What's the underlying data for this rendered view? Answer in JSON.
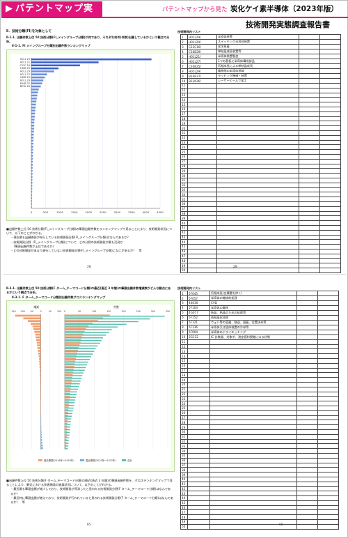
{
  "header": {
    "brand": "パテントマップ実例",
    "subtitle": "パテントマップから見た",
    "title_line1": "炭化ケイ素半導体（2023年版）",
    "title_line2": "技術開発実態調査報告書"
  },
  "page1": {
    "section_heading": "Ⅱ．技術分類(FI)を対象として",
    "subsection": "Ⅱ-1-1. 出願件数上位 50 技術分類(FI_メイングループ分類)が何であり、それぞれ何件(件数)出願しているかという観点で分析。",
    "chart_caption": "Ⅱ-1-1. FI メイングループ分類別出願件数ランキングマップ",
    "bullets": [
      "■出願件数上位 50 技術分類(FI_メイングループ分類)の筆頭出願件数をランキングマップで見ることにより、技術開発状況について、以下のことがわかる。",
      "・現在最も出願開発が先行している技術開発分野(FI_メイングループ分類)はなんであるか？",
      "・技術開発分野（FI_メイングループ分類)について、どの分野の技術開発が最も活発か",
      "（筆頭出願件数が上位であるか）",
      "・どの技術開発があまり進行していない技術開発分野(FI_メイングループ分類)になにがあるか？　等"
    ],
    "page_left": "28",
    "page_right": "29",
    "registry_title": "技術開発内リスト",
    "registry": [
      {
        "no": "1",
        "code": "H01L29/",
        "desc": "半導体装置"
      },
      {
        "no": "2",
        "code": "H01L29/",
        "desc": "スイッチング半導体装置"
      },
      {
        "no": "3",
        "code": "C23C16/",
        "desc": "化学蒸着"
      },
      {
        "no": "4",
        "code": "C30B29/",
        "desc": "単結晶成長装置等"
      },
      {
        "no": "5",
        "code": "H01L21/",
        "desc": "半導体装置製造"
      },
      {
        "no": "6",
        "code": "H01L27/",
        "desc": "1つの基板に半導体構成部品"
      },
      {
        "no": "7",
        "code": "C30B25/",
        "desc": "気相成長による単結晶成長"
      },
      {
        "no": "8",
        "code": "H01L29/",
        "desc": "電極間の半導体領域"
      },
      {
        "no": "9",
        "code": "B24B37/",
        "desc": "ラッピング機械・装置"
      },
      {
        "no": "10",
        "code": "B23K26/",
        "desc": "レーザービームで加工"
      }
    ],
    "x_ticks": [
      "0",
      "500",
      "1000",
      "1500",
      "2000",
      "2500",
      "3000",
      "3500",
      "4000",
      "4500"
    ],
    "bar_labels": [
      "H01L 29",
      "H01L 21",
      "C23C 16",
      "C30B 29",
      "H01L 29",
      "H01L 27",
      "C30B 25",
      "H01L 29",
      "B24B 37",
      "B23K 26"
    ],
    "bar_values": [
      4200,
      2350,
      1700,
      950,
      800,
      550,
      470,
      420,
      380,
      330,
      260,
      230,
      210,
      190,
      175,
      160,
      150,
      140,
      130,
      120,
      110,
      105,
      100,
      95,
      90,
      85,
      80,
      76,
      72,
      68,
      64,
      60,
      57,
      54,
      51,
      48,
      45,
      43,
      41,
      39,
      37,
      35,
      33,
      31,
      29,
      27,
      25,
      23,
      21,
      20
    ]
  },
  "page2": {
    "subsection": "Ⅱ-3-1. 出願件数上位 50 技術分類(F ターム_テーマコード分類)の最近(直近 3 年間)の筆頭出願件数増減数がどんな観点にあるかという観点で分析。",
    "chart_caption": "Ⅱ-3-1. F ターム_テーマコード分類別出願件数グロスランキングマップ",
    "left_header": "増減",
    "right_header": "件数",
    "left_ticks": [
      "-150",
      "-100",
      "-50",
      "0",
      "50",
      "100"
    ],
    "right_ticks": [
      "0",
      "50",
      "100",
      "150",
      "200",
      "250",
      "300",
      "350"
    ],
    "legend": [
      "過去期間(2016年〜2018年)",
      "直近期間(2019年〜2022年)",
      "合計"
    ],
    "legend_colors": [
      "#f0a070",
      "#6fb0e0",
      "#5bc0b0"
    ],
    "bullets": [
      "■出願件数上位 50 技術分類(F ターム_テーマコード分類)の最近(直近 3 年間)の筆頭出願件数を、グロスランキングマップで見ることにより、最近における技術開発の進展状況について、以下のことがわかる。",
      "・最近最も筆頭出願が減少しており、技術開発が停滞したと思われる技術開発分野(F ターム_テーマコード分類)はなんであるか？",
      "・最近特に筆頭出願が増えており、技術開発が行われていると思われる技術開発分野(F ターム_テーマコード分類)はなんであるか？　等"
    ],
    "page_left": "65",
    "page_right": "66",
    "registry_title": "技術開発内リスト",
    "registry": [
      {
        "no": "1",
        "code": "5F045",
        "desc": "気相成長(金属層を除く)"
      },
      {
        "no": "2",
        "code": "5F057",
        "desc": "半導体の機械的処理"
      },
      {
        "no": "3",
        "code": "4K030",
        "desc": "CVD"
      },
      {
        "no": "4",
        "code": "5F104",
        "desc": "半導体の電極"
      },
      {
        "no": "5",
        "code": "4G077",
        "desc": "結晶、結晶のための処理等"
      },
      {
        "no": "6",
        "code": "5F152",
        "desc": "再結晶化技術"
      },
      {
        "no": "7",
        "code": "5F121",
        "desc": "ウェハ等の容器、移送、固着、位置決め等"
      },
      {
        "no": "8",
        "code": "5F136",
        "desc": "半導体又は固体装置の冷却等"
      },
      {
        "no": "9",
        "code": "5F004",
        "desc": "半導体のドライエッチング"
      },
      {
        "no": "10",
        "code": "2G132",
        "desc": "IC 計数器、対象ボ、測定値判規機に以る状態"
      }
    ],
    "left_values": [
      -140,
      -95,
      -70,
      -55,
      -45,
      -40,
      -35,
      -30,
      -28,
      -25,
      -22,
      -20,
      -18,
      -16,
      -14,
      -12,
      -10,
      -9,
      -8,
      -7,
      -6,
      -5,
      -5,
      -4,
      -4,
      -3,
      -3,
      -3,
      -2,
      -2,
      -2,
      -2,
      -1,
      -1,
      -1,
      -1,
      -1,
      1,
      1,
      2,
      2,
      3,
      3,
      4,
      5,
      6,
      7,
      8,
      10,
      12
    ],
    "right_values": [
      340,
      290,
      250,
      210,
      180,
      160,
      150,
      140,
      130,
      125,
      120,
      112,
      105,
      100,
      95,
      90,
      85,
      80,
      76,
      72,
      68,
      64,
      60,
      57,
      54,
      51,
      48,
      45,
      42,
      40,
      38,
      36,
      34,
      32,
      30,
      28,
      26,
      24,
      22,
      21,
      20,
      19,
      18,
      17,
      16,
      15,
      14,
      13,
      12,
      11
    ]
  }
}
